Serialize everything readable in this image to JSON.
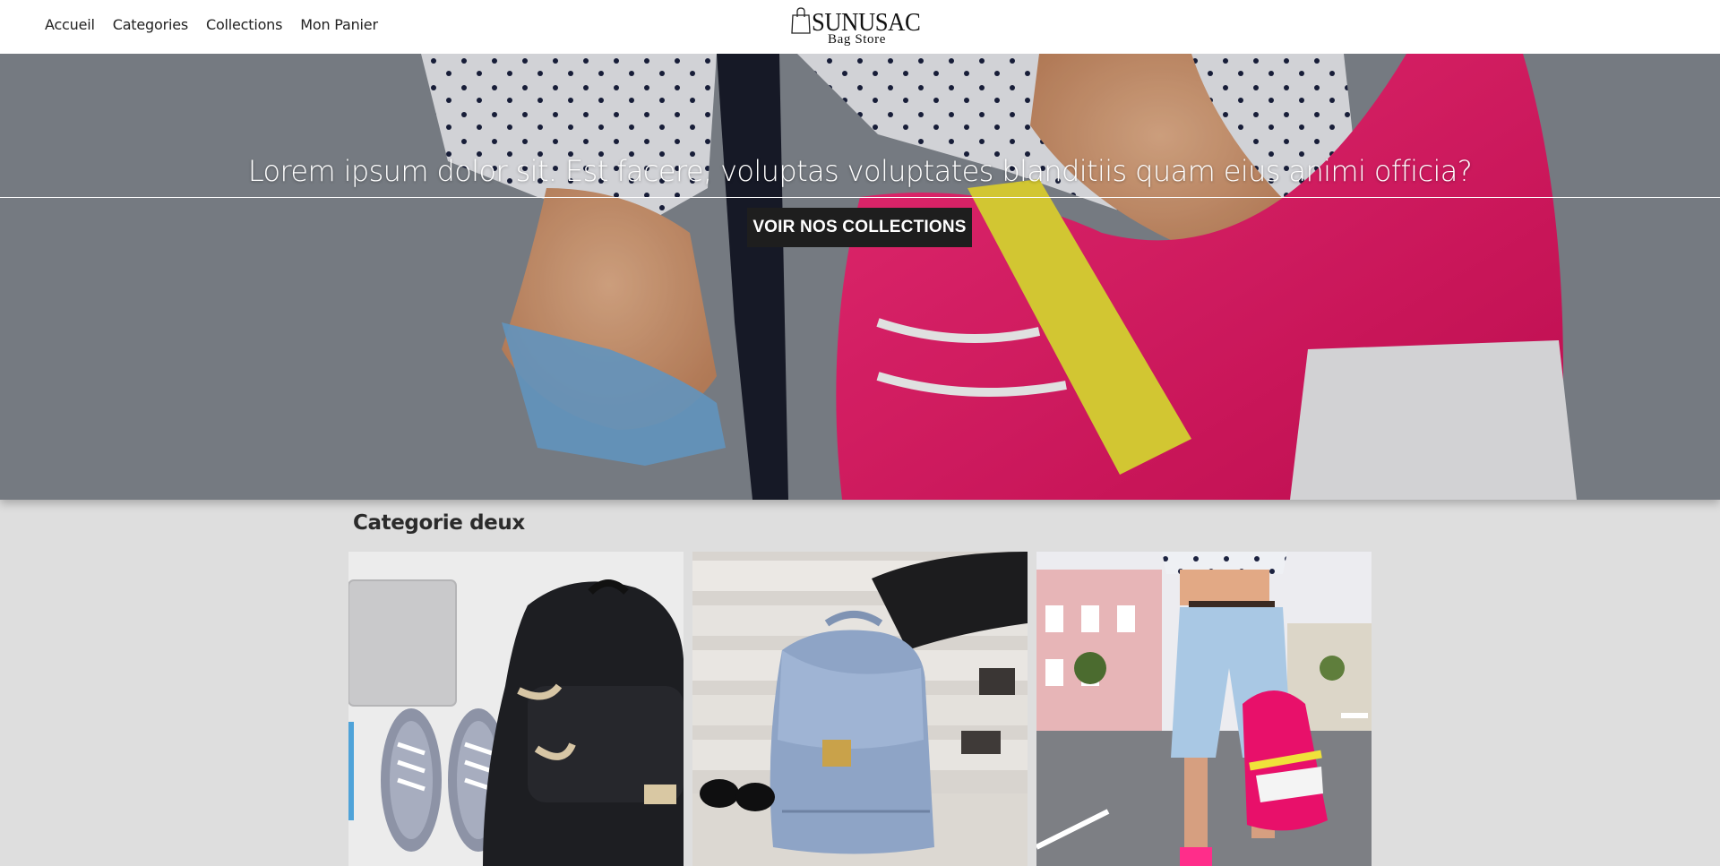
{
  "brand": {
    "name": "SUNUSAC",
    "tagline": "Bag Store"
  },
  "nav": {
    "items": [
      {
        "label": "Accueil"
      },
      {
        "label": "Categories"
      },
      {
        "label": "Collections"
      },
      {
        "label": "Mon Panier"
      }
    ]
  },
  "hero": {
    "title": "Lorem ipsum dolor sit. Est facere, voluptas voluptates blanditiis quam eius animi officia?",
    "button_label": "VOIR NOS COLLECTIONS"
  },
  "category": {
    "title": "Categorie deux",
    "products": [
      {
        "image": "black-backpack-with-sneakers-photo"
      },
      {
        "image": "blue-leather-backpack-on-bench-photo"
      },
      {
        "image": "person-with-pink-backpack-photo"
      }
    ]
  },
  "colors": {
    "header_bg": "#ffffff",
    "page_bg": "#dedede",
    "button_bg": "#1e1e1e",
    "text_dark": "#222222"
  }
}
